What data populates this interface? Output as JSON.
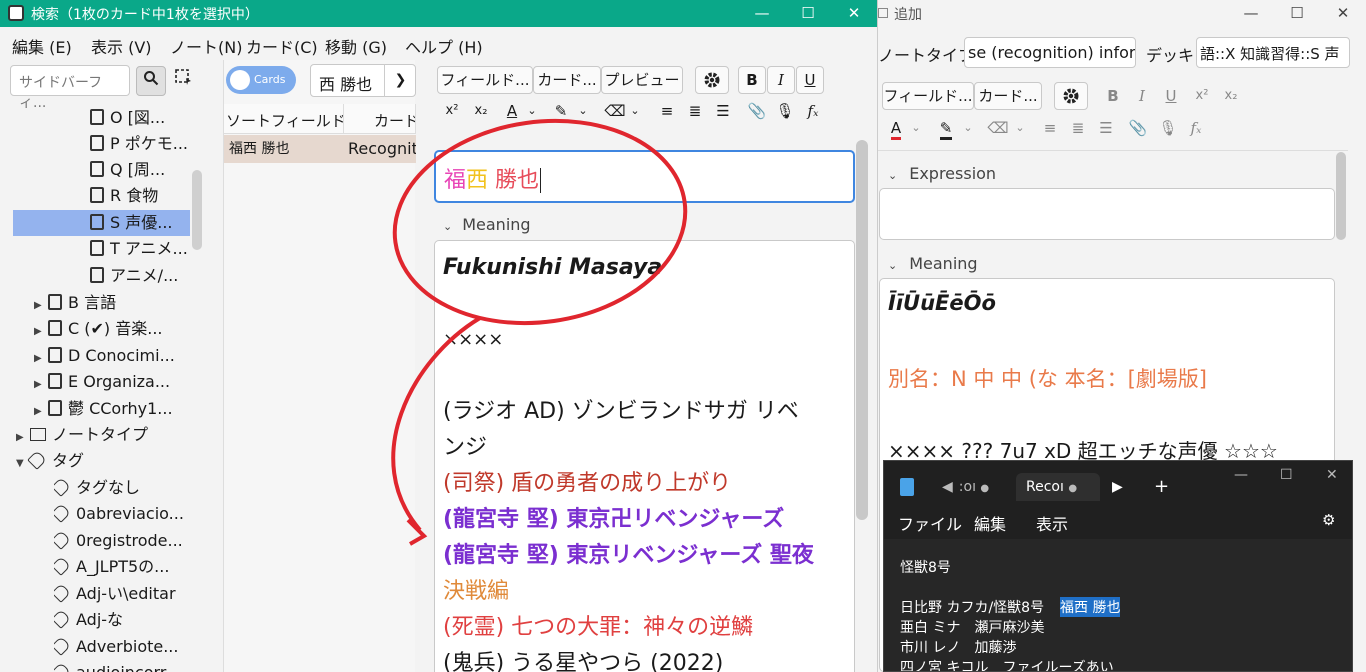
{
  "browse": {
    "title": "検索（1枚のカード中1枚を選択中）",
    "menu": [
      "編集 (E)",
      "表示 (V)",
      "ノート(N)",
      "カード(C)",
      "移動 (G)",
      "ヘルプ (H)"
    ],
    "sidebar": {
      "search_placeholder": "サイドバーフィ...",
      "items": [
        {
          "label": "O [図...",
          "level": 3
        },
        {
          "label": "P ポケモ...",
          "level": 3
        },
        {
          "label": "Q [周...",
          "level": 3
        },
        {
          "label": "R 食物",
          "level": 3
        },
        {
          "label": "S 声優...",
          "level": 3,
          "selected": true
        },
        {
          "label": "T アニメ...",
          "level": 3
        },
        {
          "label": "アニメ/...",
          "level": 3
        },
        {
          "label": "B 言語",
          "level": 2
        },
        {
          "label": "C (✔) 音楽...",
          "level": 2
        },
        {
          "label": "D Conocimi...",
          "level": 2
        },
        {
          "label": "E Organiza...",
          "level": 2
        },
        {
          "label": "鬱 CCorhy1...",
          "level": 2
        }
      ],
      "notetype_label": "ノートタイプ",
      "tags_label": "タグ",
      "tags": [
        "タグなし",
        "0abreviacio...",
        "0registrode...",
        "A_JLPT5の...",
        "Adj-い\\editar",
        "Adj-な",
        "Adverbiote...",
        "audioincorr..."
      ]
    },
    "cardlist": {
      "toggle_label": "Cards",
      "search_value": "西 勝也",
      "columns": [
        "ソートフィールド",
        "カード"
      ],
      "row": [
        "福西 勝也",
        "Recognit"
      ]
    },
    "editor": {
      "buttons": [
        "フィールド...",
        "カード...",
        "プレビュー"
      ],
      "format_buttons": [
        "B",
        "I",
        "U",
        "x²",
        "x₂"
      ],
      "expression_value_1": "福",
      "expression_value_2": "西",
      "expression_value_3": " 勝也",
      "meaning_label": "Meaning",
      "meaning_title": "Fukunishi Masaya",
      "meaning_lines": [
        "××××",
        "(ラジオ AD) ゾンビランドサガ リベ",
        "ンジ",
        "(司祭) 盾の勇者の成り上がり",
        "(龍宮寺 堅) 東京卍リベンジャーズ",
        "(龍宮寺 堅) 東京リベンジャーズ 聖夜",
        "決戦編",
        "(死霊) 七つの大罪：神々の逆鱗",
        "(鬼兵) うる星やつら (2022)"
      ]
    }
  },
  "add": {
    "title": "追加",
    "notetype_label": "ノートタイプ",
    "notetype_value": "se (recognition) infor",
    "deck_label": "デッキ",
    "deck_value": "語::X 知識習得::S 声",
    "buttons": [
      "フィールド...",
      "カード..."
    ],
    "format_buttons": [
      "B",
      "I",
      "U",
      "x²",
      "x₂"
    ],
    "expression_label": "Expression",
    "meaning_label": "Meaning",
    "meaning_line1": "ĪīŪūĒēŌō",
    "meaning_line2": "別名：N 中 中 (な 本名：[劇場版]",
    "meaning_line3": "×××× ??? 7u7 xD 超エッチな声優 ☆☆☆"
  },
  "notepad": {
    "tab1": ":oı",
    "tab2": "Recoı",
    "menu": [
      "ファイル",
      "編集",
      "表示"
    ],
    "lines": [
      "怪獣8号",
      "",
      "日比野 カフカ/怪獣8号",
      "亜白 ミナ　瀬戸麻沙美",
      "市川 レノ　加藤渉",
      "四ノ宮 キコル　ファイルーズあい"
    ],
    "highlight": "福西 勝也"
  },
  "colors": {
    "titlebar": "#0aa889",
    "selected": "#94b3ee",
    "annotation": "#e0262e"
  }
}
